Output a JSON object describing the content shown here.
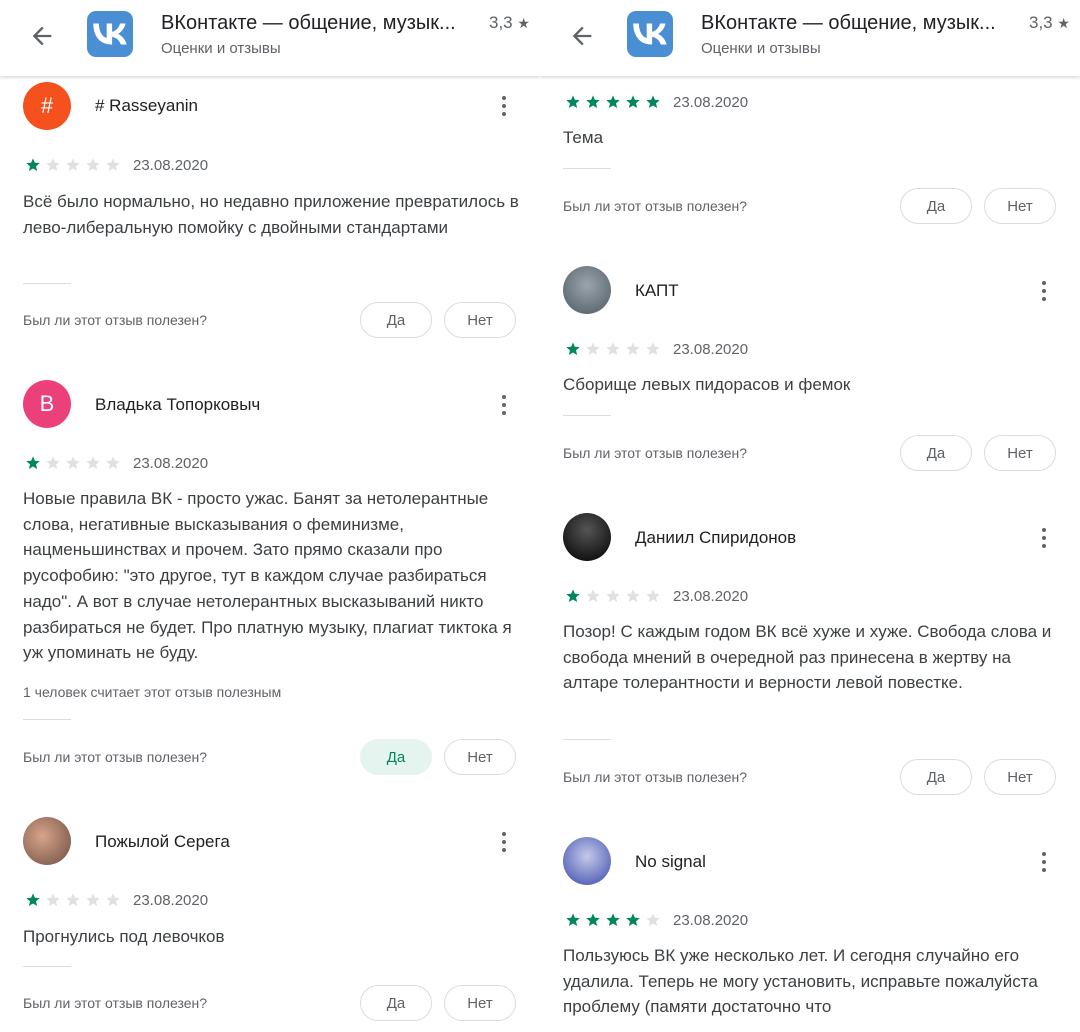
{
  "panels": [
    {
      "app": {
        "title": "ВКонтакте — общение, музык...",
        "subtitle": "Оценки и отзывы",
        "rating": "3,3"
      },
      "reviews": [
        {
          "author": "# Rasseyanin",
          "avatar_letter": "#",
          "avatar_color": "#f4511e",
          "rating": 1,
          "date": "23.08.2020",
          "text": "Всё было нормально, но недавно приложение превратилось в лево-либеральную помойку с двойными стандартами"
        },
        {
          "author": "Владька Топорковыч",
          "avatar_letter": "В",
          "avatar_color": "#ec407a",
          "rating": 1,
          "date": "23.08.2020",
          "text": "Новые правила ВК - просто ужас. Банят за нетолерантные слова, негативные высказывания о феминизме, нацменьшинствах и прочем. Зато прямо сказали про русофобию: \"это другое, тут в каждом случае разбираться надо\". А вот в случае нетолерантных высказываний никто разбираться не будет. Про платную музыку, плагиат тиктока я уж упоминать не буду.",
          "helpful_count": "1 человек считает этот отзыв полезным"
        },
        {
          "author": "Пожылой Серега",
          "avatar_letter": "",
          "avatar_color": "#8d6e63",
          "rating": 1,
          "date": "23.08.2020",
          "text": "Прогнулись под левочков"
        }
      ]
    },
    {
      "app": {
        "title": "ВКонтакте — общение, музык...",
        "subtitle": "Оценки и отзывы",
        "rating": "3,3"
      },
      "reviews": [
        {
          "rating": 5,
          "date": "23.08.2020",
          "text": "Тема"
        },
        {
          "author": "КАПТ",
          "avatar_letter": "",
          "avatar_color": "#6d7b85",
          "rating": 1,
          "date": "23.08.2020",
          "text": "Сборище левых пидорасов и фемок"
        },
        {
          "author": "Даниил Спиридонов",
          "avatar_letter": "",
          "avatar_color": "#1a1a1a",
          "rating": 1,
          "date": "23.08.2020",
          "text": "Позор! С каждым годом ВК всё хуже и хуже. Свобода слова и свобода мнений в очередной раз принесена в жертву на алтаре толерантности и верности левой повестке."
        },
        {
          "author": "No signal",
          "avatar_letter": "",
          "avatar_color": "#5c6bc0",
          "rating": 4,
          "date": "23.08.2020",
          "text": "Пользуюсь ВК уже несколько лет. И сегодня случайно его удалила. Теперь не могу установить, исправьте пожалуйста проблему (памяти достаточно что"
        }
      ]
    }
  ],
  "ui": {
    "helpful_question": "Был ли этот отзыв полезен?",
    "yes": "Да",
    "no": "Нет",
    "star_filled_color": "#01875f",
    "star_empty_color": "#e0e0e0",
    "icons": {
      "back": "arrow-left-icon",
      "app": "vk-logo-icon",
      "rating_star": "star-icon",
      "menu": "more-vert-icon"
    }
  }
}
